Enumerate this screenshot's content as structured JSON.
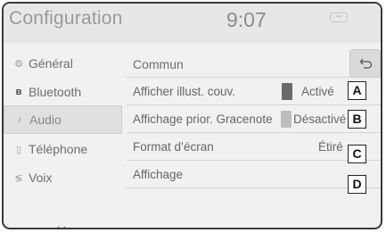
{
  "header": {
    "title": "Configuration",
    "clock": "9:07"
  },
  "sidebar": {
    "items": [
      {
        "label": "Général",
        "icon": "gear-icon"
      },
      {
        "label": "Bluetooth",
        "icon": "bluetooth-icon"
      },
      {
        "label": "Audio",
        "icon": "music-note-icon",
        "selected": true
      },
      {
        "label": "Téléphone",
        "icon": "phone-icon"
      },
      {
        "label": "Voix",
        "icon": "voice-icon"
      }
    ]
  },
  "section": {
    "title": "Commun"
  },
  "rows": [
    {
      "label": "Afficher illust. couv.",
      "value": "Activé",
      "badge": "A",
      "indicator": "on"
    },
    {
      "label": "Affichage prior. Gracenote",
      "value": "Désactivé",
      "badge": "B",
      "indicator": "off"
    },
    {
      "label": "Format d’écran",
      "value": "Étiré",
      "badge": "C"
    },
    {
      "label": "Affichage",
      "value": "",
      "badge": "D"
    }
  ],
  "colors": {
    "indicator_on": "#6a6a6a",
    "indicator_off": "#bdbdbd"
  }
}
